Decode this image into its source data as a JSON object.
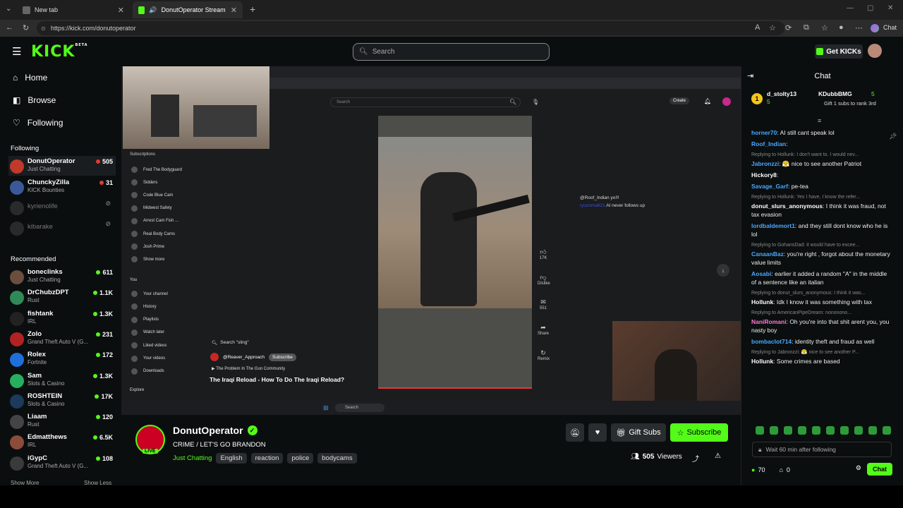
{
  "browser": {
    "tabs": [
      {
        "title": "New tab"
      },
      {
        "title": "DonutOperator Stream - Watc"
      }
    ],
    "url": "https://kick.com/donutoperator",
    "chat_label": "Chat"
  },
  "kick": {
    "logo": "KICK",
    "logo_badge": "BETA",
    "search_placeholder": "Search",
    "get_kicks": "Get KICKs"
  },
  "sidebar": {
    "nav": [
      {
        "label": "Home",
        "icon": "home-icon"
      },
      {
        "label": "Browse",
        "icon": "compass-icon"
      },
      {
        "label": "Following",
        "icon": "heart-icon"
      }
    ],
    "following_header": "Following",
    "following": [
      {
        "name": "DonutOperator",
        "category": "Just Chatting",
        "viewers": "505",
        "color": "#c0392b",
        "live": true
      },
      {
        "name": "ChunckyZilla",
        "category": "KICK Bounties",
        "viewers": "31",
        "color": "#3b5998",
        "live": true
      },
      {
        "name": "kyrienolife",
        "category": "",
        "viewers": "",
        "color": "#555",
        "live": false
      },
      {
        "name": "kibarake",
        "category": "",
        "viewers": "",
        "color": "#555",
        "live": false
      }
    ],
    "recommended_header": "Recommended",
    "recommended": [
      {
        "name": "boneclinks",
        "category": "Just Chatting",
        "viewers": "611",
        "color": "#6b4e3d"
      },
      {
        "name": "DrChubzDPT",
        "category": "Rust",
        "viewers": "1.1K",
        "color": "#2e8b57"
      },
      {
        "name": "fishtank",
        "category": "IRL",
        "viewers": "1.3K",
        "color": "#222"
      },
      {
        "name": "Zolo",
        "category": "Grand Theft Auto V (G...",
        "viewers": "231",
        "color": "#b22222"
      },
      {
        "name": "Rolex",
        "category": "Fortnite",
        "viewers": "172",
        "color": "#1e6fd9"
      },
      {
        "name": "Sam",
        "category": "Slots & Casino",
        "viewers": "1.3K",
        "color": "#27ae60"
      },
      {
        "name": "ROSHTEIN",
        "category": "Slots & Casino",
        "viewers": "17K",
        "color": "#1b3a5c"
      },
      {
        "name": "Liaam",
        "category": "Rust",
        "viewers": "120",
        "color": "#444"
      },
      {
        "name": "Edmatthews",
        "category": "IRL",
        "viewers": "6.5K",
        "color": "#8b4c3a"
      },
      {
        "name": "iGypC",
        "category": "Grand Theft Auto V (G...",
        "viewers": "108",
        "color": "#3a3a3a"
      }
    ],
    "show_more": "Show More",
    "show_less": "Show Less"
  },
  "player": {
    "yt_sections": {
      "subscriptions": "Subscriptions",
      "subs": [
        "Fred The Bodyguard",
        "Sidders",
        "Code Blue Cam",
        "Midwest Safety",
        "Arrest Cam Fish ...",
        "Real Body Cams",
        "Josh Prime",
        "Show more"
      ],
      "you": "You",
      "you_items": [
        "Your channel",
        "History",
        "Playlists",
        "Watch later",
        "Liked videos",
        "Your videos",
        "Downloads"
      ],
      "explore": "Explore"
    },
    "yt_search": "Search",
    "yt_create": "Create",
    "short_channel": "@Reaver_Approach",
    "short_subscribe": "Subscribe",
    "short_search": "Search \"sling\"",
    "short_playlist": "The Problem In The Gun Community",
    "short_title": "The Iraqi Reload - How To Do The Iraqi Reload?",
    "side_actions": [
      {
        "icon": "thumbs-up-icon",
        "label": "17K"
      },
      {
        "icon": "thumbs-down-icon",
        "label": "Dislike"
      },
      {
        "icon": "comment-icon",
        "label": "551"
      },
      {
        "icon": "share-icon",
        "label": "Share"
      },
      {
        "icon": "remix-icon",
        "label": "Remix"
      }
    ],
    "overlay_chat": [
      {
        "user": "",
        "text": "@Roof_Indian yo!!!"
      },
      {
        "user": "ryuzoma821",
        "text": "AI never follows up"
      }
    ],
    "taskbar_search": "Search"
  },
  "stream": {
    "streamer": "DonutOperator",
    "live_badge": "LIVE",
    "title": "CRIME / LET'S GO BRANDON",
    "category": "Just Chatting",
    "tags": [
      "English",
      "reaction",
      "police",
      "bodycams"
    ],
    "gift_subs": "Gift Subs",
    "subscribe": "Subscribe",
    "viewers": "505",
    "viewers_label": "Viewers"
  },
  "chat": {
    "title": "Chat",
    "pinned": {
      "user1": "d_stolty13",
      "user1_count": "5",
      "user2": "KDubbBMG",
      "user2_count": "5",
      "note": "Gift 1 subs to rank 3rd"
    },
    "messages": [
      {
        "reply": "",
        "user": "horner70",
        "color": "#4aa8ff",
        "text": ": AI still cant speak lol"
      },
      {
        "reply": "",
        "user": "Roof_Indian",
        "color": "#4aa8ff",
        "text": ":"
      },
      {
        "reply": "Replying to Hollunk: I don't want to. I would nev...",
        "user": "Jabronzzi",
        "color": "#4aa8ff",
        "text": ": 😤 nice to see another Patriot"
      },
      {
        "reply": "",
        "user": "Hickory8",
        "color": "#ffffff",
        "text": ":"
      },
      {
        "reply": "",
        "user": "Savage_Garf",
        "color": "#4aa8ff",
        "text": ": pe-tea"
      },
      {
        "reply": "Replying to Hollunk: Yes I have, I know the refer...",
        "user": "donut_slurs_anonymous",
        "color": "#ffffff",
        "text": ": I think it was fraud, not tax evasion"
      },
      {
        "reply": "",
        "user": "lordbaldemort1",
        "color": "#4aa8ff",
        "text": ": and they still dont know who he is lol"
      },
      {
        "reply": "Replying to GohansDad: it would have to excee...",
        "user": "CanaanBaz",
        "color": "#4aa8ff",
        "text": ": you're right , forgot about the monetary value limits"
      },
      {
        "reply": "",
        "user": "Aosabi",
        "color": "#4aa8ff",
        "text": ": earlier it added a random \"A\" in the middle of a sentence like an italian"
      },
      {
        "reply": "Replying to donut_slurs_anonymous: I think it was...",
        "user": "Hollunk",
        "color": "#ffffff",
        "text": ": Idk I know it was something with tax"
      },
      {
        "reply": "Replying to AmericanPipeDream: nononono...",
        "user": "NaniRomani",
        "color": "#ff7ad0",
        "text": ": Oh you're into that shit arent you, you nasty boy"
      },
      {
        "reply": "",
        "user": "bombaclot714",
        "color": "#4aa8ff",
        "text": ": identity theft and fraud as well"
      },
      {
        "reply": "Replying to Jabronzzi: 😤 nice to see another P...",
        "user": "Hollunk",
        "color": "#ffffff",
        "text": ": Some crimes are based"
      }
    ],
    "input_placeholder": "Wait 60 min after following",
    "kicks_count": "70",
    "gift_count": "0",
    "send_label": "Chat"
  }
}
